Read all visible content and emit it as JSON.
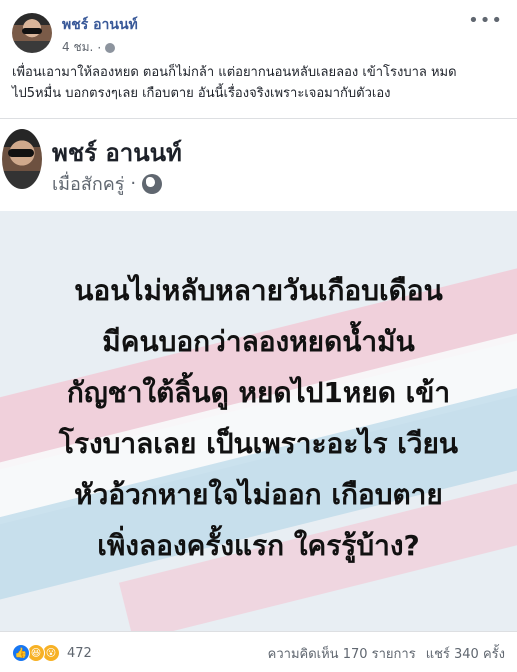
{
  "post": {
    "author": "พชร์ อานนท์",
    "time": "4 ชม.",
    "more_icon": "more-dots-icon",
    "privacy_icon": "globe-icon",
    "caption": "เพื่อนเอามาให้ลองหยด ตอนก็ไม่กล้า แต่อยากนอนหลับเลยลอง เข้าโรงบาล หมดไป5หมื่น บอกตรงๆเลย เกือบตาย อันนี้เรื่องจริงเพราะเจอมากับตัวเอง"
  },
  "shared": {
    "author": "พชร์ อานนท์",
    "time": "เมื่อสักครู่",
    "separator": "·",
    "privacy_icon": "globe-icon",
    "poster_lines": [
      "นอนไม่หลับหลายวันเกือบเดือน",
      "มีคนบอกว่าลองหยดน้ำมัน",
      "กัญชาใต้ลิ้นดู หยดไป1หยด เข้า",
      "โรงบาลเลย เป็นเพราะอะไร เวียน",
      "หัวอ้วกหายใจไม่ออก เกือบตาย",
      "เพิ่งลองครั้งแรก ใครรู้บ้าง?"
    ]
  },
  "footer": {
    "reaction_count": "472",
    "reaction_icons": [
      "like-icon",
      "haha-icon",
      "wow-icon"
    ],
    "comments": "ความคิดเห็น 170 รายการ",
    "shares": "แชร์ 340 ครั้ง"
  },
  "colors": {
    "link": "#385898",
    "like": "#1877f2",
    "emoji": "#f7b125",
    "poster_bg": "#e8eef3",
    "stripe_pink": "#f3c6d3",
    "stripe_blue": "#bcd9ea"
  }
}
